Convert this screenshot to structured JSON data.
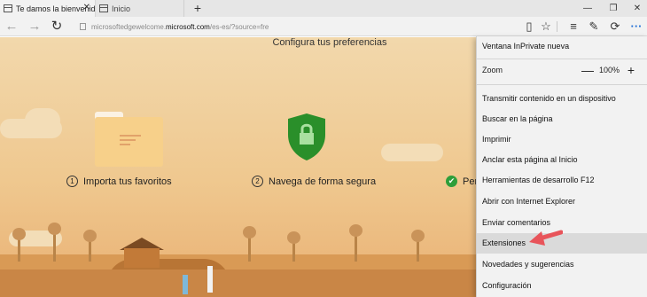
{
  "browser": {
    "tabs": [
      {
        "label": "Te damos la bienvenida",
        "close": "✕"
      },
      {
        "label": "Inicio"
      }
    ],
    "new_tab": "+",
    "window_controls": {
      "minimize": "—",
      "restore": "❐",
      "close": "✕"
    },
    "address": {
      "path": "microsoftedgewelcome.",
      "host": "microsoft.com",
      "rest": "/es-es/?source=fre"
    },
    "icons": {
      "back": "←",
      "forward": "→",
      "refresh": "↻",
      "reading_view": "▯",
      "favorite": "☆",
      "hub": "≡",
      "notes": "✎",
      "share": "⟳",
      "more": "···"
    }
  },
  "page": {
    "title": "Configura tus preferencias",
    "steps": [
      {
        "num": "1",
        "label": "Importa tus favoritos"
      },
      {
        "num": "2",
        "label": "Navega de forma segura"
      },
      {
        "num": "✔",
        "label": "Per"
      }
    ]
  },
  "menu": {
    "items_top": [
      "Ventana InPrivate nueva"
    ],
    "zoom": {
      "label": "Zoom",
      "minus": "—",
      "value": "100%",
      "plus": "+"
    },
    "items": [
      "Transmitir contenido en un dispositivo",
      "Buscar en la página",
      "Imprimir",
      "Anclar esta página al Inicio",
      "Herramientas de desarrollo F12",
      "Abrir con Internet Explorer",
      "Enviar comentarios",
      "Extensiones",
      "Novedades y sugerencias",
      "Configuración"
    ],
    "highlighted": "Extensiones"
  },
  "colors": {
    "accent_check": "#2e9e3a",
    "shield": "#2a8f2a",
    "arrow": "#e8545a"
  }
}
